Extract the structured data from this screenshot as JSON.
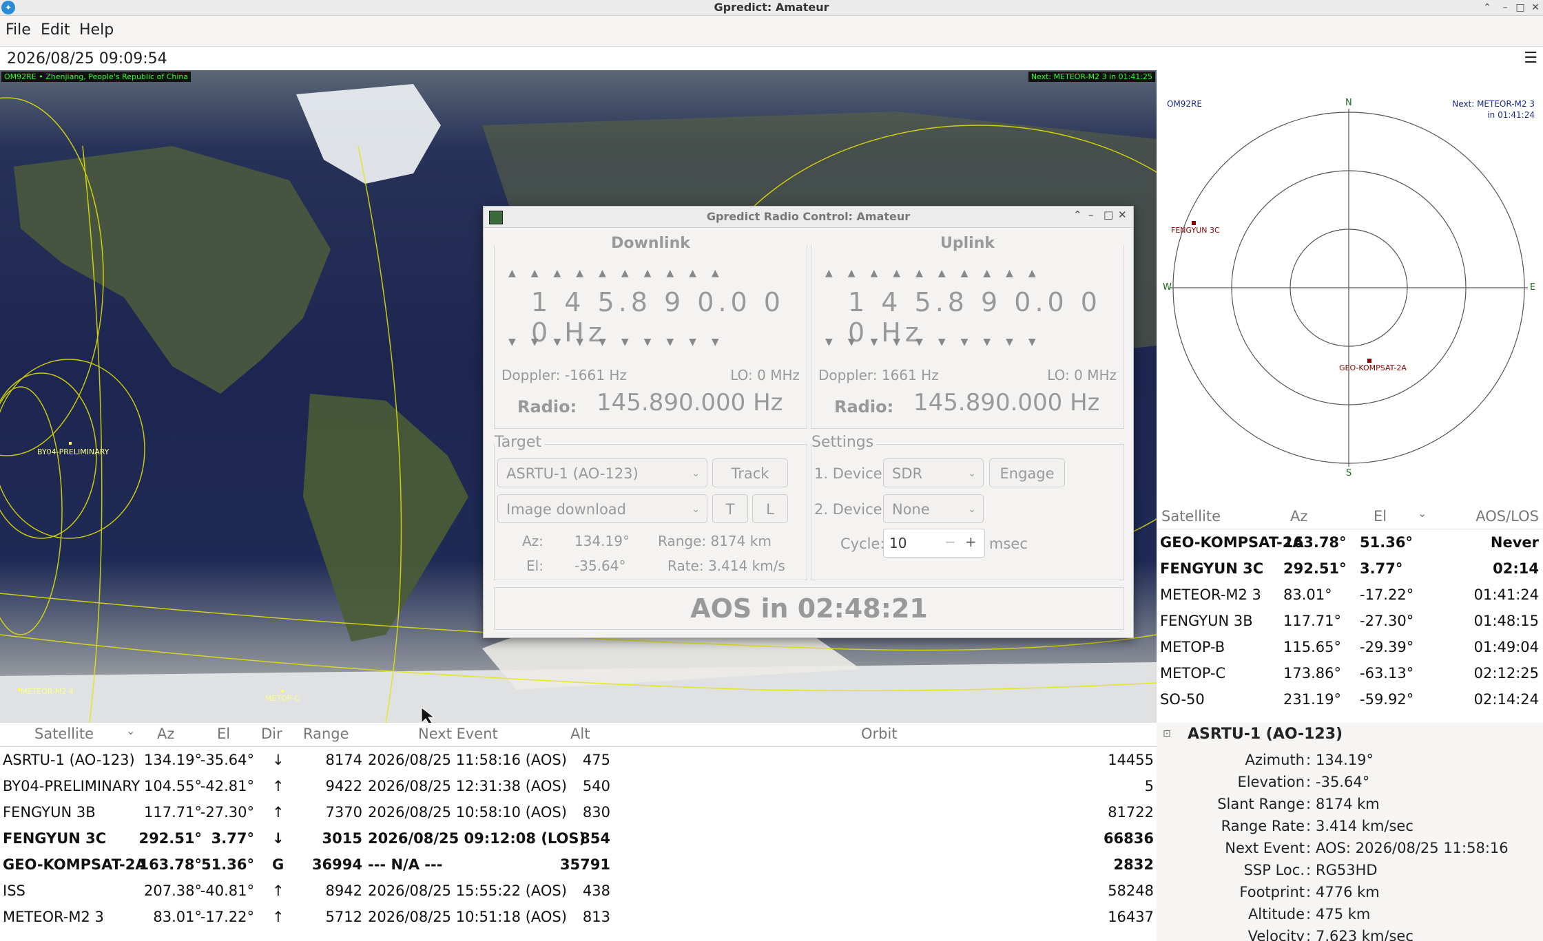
{
  "window": {
    "title": "Gpredict: Amateur"
  },
  "menu": [
    "File",
    "Edit",
    "Help"
  ],
  "datetime": "2026/08/25 09:09:54",
  "map": {
    "qth_label": "OM92RE  •  Zhenjiang, People's Republic of China",
    "next_label": "Next: METEOR-M2 3 in 01:41:25",
    "sat_labels": [
      "BY04-PRELIMINARY",
      "METEOR-M2 4",
      "METOP-C"
    ]
  },
  "radio": {
    "title": "Gpredict Radio Control: Amateur",
    "downlink": {
      "title": "Downlink",
      "freq": "1 4 5.8 9 0.0 0 0 Hz",
      "doppler": "Doppler: -1661 Hz",
      "lo": "LO: 0 MHz",
      "radio_label": "Radio:",
      "radio_value": "145.890.000 Hz"
    },
    "uplink": {
      "title": "Uplink",
      "freq": "1 4 5.8 9 0.0 0 0 Hz",
      "doppler": "Doppler: 1661 Hz",
      "lo": "LO: 0 MHz",
      "radio_label": "Radio:",
      "radio_value": "145.890.000 Hz"
    },
    "target": {
      "title": "Target",
      "satellite": "ASRTU-1 (AO-123)",
      "track": "Track",
      "transponder": "Image download",
      "t": "T",
      "l": "L",
      "az_label": "Az:",
      "az": "134.19°",
      "el_label": "El:",
      "el": "-35.64°",
      "range": "Range: 8174 km",
      "rate": "Rate: 3.414 km/s"
    },
    "settings": {
      "title": "Settings",
      "dev1_label": "1. Device:",
      "dev1": "SDR",
      "engage": "Engage",
      "dev2_label": "2. Device:",
      "dev2": "None",
      "cycle_label": "Cycle:",
      "cycle": "10",
      "minus": "−",
      "plus": "+",
      "unit": "msec"
    },
    "aos": "AOS in 02:48:21"
  },
  "polar": {
    "qth": "OM92RE",
    "next_line1": "Next: METEOR-M2 3",
    "next_line2": "in 01:41:24",
    "n": "N",
    "s": "S",
    "e": "E",
    "w": "W",
    "sats": [
      "FENGYUN 3C",
      "GEO-KOMPSAT-2A"
    ]
  },
  "sat_table": {
    "headers": [
      "Satellite",
      "Az",
      "El",
      "AOS/LOS"
    ],
    "rows": [
      {
        "name": "GEO-KOMPSAT-2A",
        "az": "163.78°",
        "el": "51.36°",
        "aos": "Never",
        "bold": true
      },
      {
        "name": "FENGYUN 3C",
        "az": "292.51°",
        "el": "3.77°",
        "aos": "02:14",
        "bold": true
      },
      {
        "name": "METEOR-M2 3",
        "az": "83.01°",
        "el": "-17.22°",
        "aos": "01:41:24",
        "bold": false
      },
      {
        "name": "FENGYUN 3B",
        "az": "117.71°",
        "el": "-27.30°",
        "aos": "01:48:15",
        "bold": false
      },
      {
        "name": "METOP-B",
        "az": "115.65°",
        "el": "-29.39°",
        "aos": "01:49:04",
        "bold": false
      },
      {
        "name": "METOP-C",
        "az": "173.86°",
        "el": "-63.13°",
        "aos": "02:12:25",
        "bold": false
      },
      {
        "name": "SO-50",
        "az": "231.19°",
        "el": "-59.92°",
        "aos": "02:14:24",
        "bold": false
      }
    ]
  },
  "bottom_table": {
    "headers": [
      "Satellite",
      "Az",
      "El",
      "Dir",
      "Range",
      "Next Event",
      "Alt",
      "Orbit"
    ],
    "rows": [
      {
        "name": "ASRTU-1 (AO-123)",
        "az": "134.19°",
        "el": "-35.64°",
        "dir": "↓",
        "range": "8174",
        "next": "2026/08/25 11:58:16 (AOS)",
        "alt": "475",
        "orbit": "14455",
        "bold": false
      },
      {
        "name": "BY04-PRELIMINARY",
        "az": "104.55°",
        "el": "-42.81°",
        "dir": "↑",
        "range": "9422",
        "next": "2026/08/25 12:31:38 (AOS)",
        "alt": "540",
        "orbit": "5",
        "bold": false
      },
      {
        "name": "FENGYUN 3B",
        "az": "117.71°",
        "el": "-27.30°",
        "dir": "↑",
        "range": "7370",
        "next": "2026/08/25 10:58:10 (AOS)",
        "alt": "830",
        "orbit": "81722",
        "bold": false
      },
      {
        "name": "FENGYUN 3C",
        "az": "292.51°",
        "el": "3.77°",
        "dir": "↓",
        "range": "3015",
        "next": "2026/08/25 09:12:08 (LOS)",
        "alt": "854",
        "orbit": "66836",
        "bold": true
      },
      {
        "name": "GEO-KOMPSAT-2A",
        "az": "163.78°",
        "el": "51.36°",
        "dir": "G",
        "range": "36994",
        "next": "--- N/A ---",
        "alt": "35791",
        "orbit": "2832",
        "bold": true
      },
      {
        "name": "ISS",
        "az": "207.38°",
        "el": "-40.81°",
        "dir": "↑",
        "range": "8942",
        "next": "2026/08/25 15:55:22 (AOS)",
        "alt": "438",
        "orbit": "58248",
        "bold": false
      },
      {
        "name": "METEOR-M2 3",
        "az": "83.01°",
        "el": "-17.22°",
        "dir": "↑",
        "range": "5712",
        "next": "2026/08/25 10:51:18 (AOS)",
        "alt": "813",
        "orbit": "16437",
        "bold": false
      }
    ]
  },
  "details": {
    "title": "ASRTU-1 (AO-123)",
    "rows": [
      {
        "label": "Azimuth",
        "value": "134.19°"
      },
      {
        "label": "Elevation",
        "value": "-35.64°"
      },
      {
        "label": "Slant Range",
        "value": "8174 km"
      },
      {
        "label": "Range Rate",
        "value": "3.414 km/sec"
      },
      {
        "label": "Next Event",
        "value": "AOS: 2026/08/25 11:58:16"
      },
      {
        "label": "SSP Loc.",
        "value": "RG53HD"
      },
      {
        "label": "Footprint",
        "value": "4776 km"
      },
      {
        "label": "Altitude",
        "value": "475 km"
      },
      {
        "label": "Velocity",
        "value": "7.623 km/sec"
      }
    ]
  }
}
